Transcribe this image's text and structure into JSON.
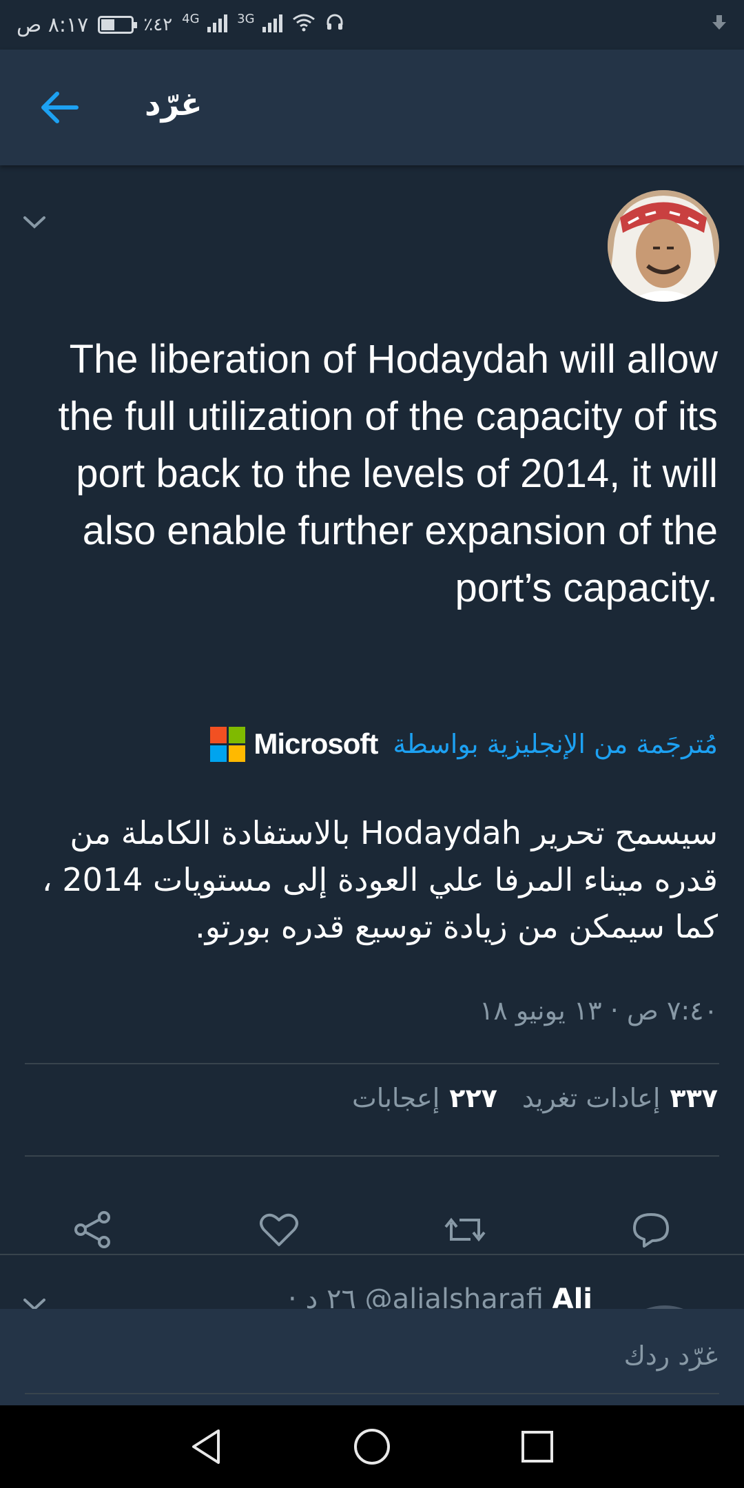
{
  "status_bar": {
    "time": "٨:١٧ ص",
    "battery_percent": "٪٤٢",
    "network_1": "4G",
    "network_2": "3G"
  },
  "app_bar": {
    "title": "غرّد"
  },
  "tweet": {
    "text": "The liberation of Hodaydah will allow  the full utilization of the capacity of its port  back to the levels of 2014, it will also enable further expansion of the port’s capacity.",
    "translated_label": "مُترجَمة من الإنجليزية بواسطة",
    "translator": "Microsoft",
    "translation": "سيسمح تحرير Hodaydah بالاستفادة الكاملة من قدره ميناء المرفا علي العودة إلى مستويات 2014 ، كما سيمكن من زيادة توسيع قدره بورتو.",
    "timestamp": "٧:٤٠ ص · ١٣ يونيو ١٨",
    "retweets_count": "٣٣٧",
    "retweets_label": "إعادات تغريد",
    "likes_count": "٢٢٧",
    "likes_label": "إعجابات"
  },
  "reply": {
    "name": "Ali",
    "handle": "@alialsharafi",
    "age": "· ٢٦ د"
  },
  "compose": {
    "placeholder": "غرّد ردك"
  },
  "colors": {
    "background": "#1b2836",
    "app_bar": "#243447",
    "accent": "#1da1f2",
    "muted": "#8899a6",
    "divider": "#38444d"
  }
}
